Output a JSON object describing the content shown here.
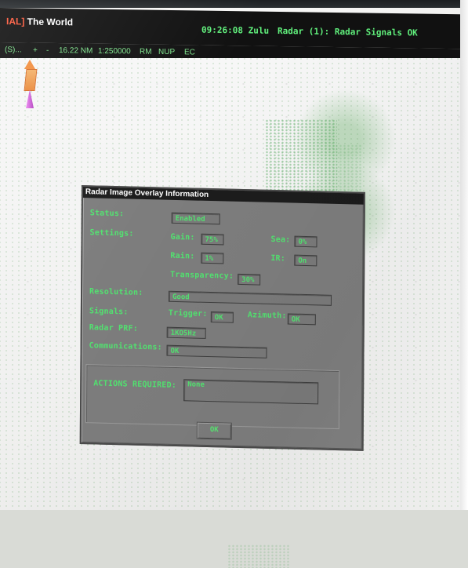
{
  "topbar": {
    "title_tag": "IAL]",
    "title_text": "The World",
    "clock": "09:26:08 Zulu",
    "radar_status": "Radar (1): Radar Signals OK"
  },
  "secondbar": {
    "segment": "(S)...",
    "plus": "+",
    "minus": "-",
    "distance": "16.22 NM",
    "scale": "1:250000",
    "rm": "RM",
    "nup": "NUP",
    "ec": "EC"
  },
  "icons": {
    "ship": "ship-icon"
  },
  "dialog": {
    "title": "Radar Image Overlay Information",
    "status_label": "Status:",
    "status_value": "Enabled",
    "settings_label": "Settings:",
    "gain_label": "Gain:",
    "gain_value": "75%",
    "sea_label": "Sea:",
    "sea_value": "0%",
    "rain_label": "Rain:",
    "rain_value": "1%",
    "ir_label": "IR:",
    "ir_value": "On",
    "transparency_label": "Transparency:",
    "transparency_value": "30%",
    "resolution_label": "Resolution:",
    "resolution_value": "Good",
    "signals_label": "Signals:",
    "trigger_label": "Trigger:",
    "trigger_value": "OK",
    "azimuth_label": "Azimuth:",
    "azimuth_value": "OK",
    "prf_label": "Radar PRF:",
    "prf_value": "1KO5Hz",
    "communications_label": "Communications:",
    "communications_value": "OK",
    "actions_label": "ACTIONS REQUIRED:",
    "actions_value": "None",
    "ok_button": "OK"
  }
}
